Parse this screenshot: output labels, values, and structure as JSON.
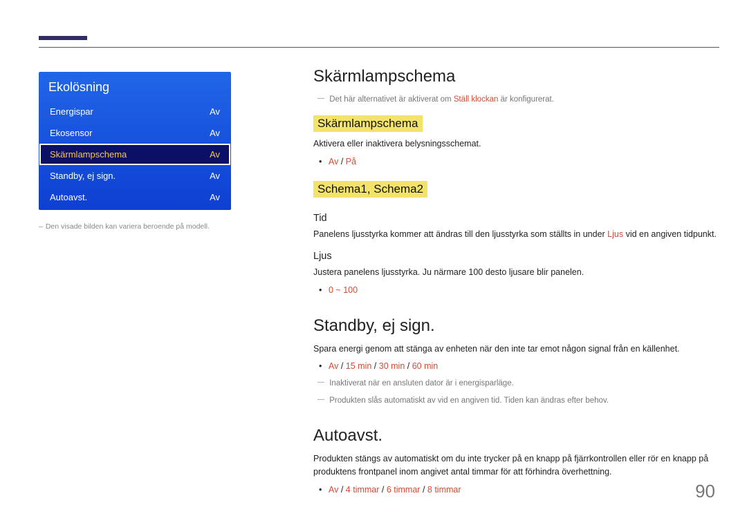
{
  "page_number": "90",
  "sidebar": {
    "title": "Ekolösning",
    "note_prefix": "–",
    "note": "Den visade bilden kan variera beroende på modell.",
    "items": [
      {
        "label": "Energispar",
        "value": "Av",
        "selected": false
      },
      {
        "label": "Ekosensor",
        "value": "Av",
        "selected": false
      },
      {
        "label": "Skärmlampschema",
        "value": "Av",
        "selected": true
      },
      {
        "label": "Standby, ej sign.",
        "value": "Av",
        "selected": false
      },
      {
        "label": "Autoavst.",
        "value": "Av",
        "selected": false
      }
    ]
  },
  "content": {
    "s1": {
      "h1": "Skärmlampschema",
      "note1_prefix": "―",
      "note1_a": "Det här alternativet är aktiverat om ",
      "note1_red": "Ställ klockan",
      "note1_b": " är konfigurerat.",
      "h2a": "Skärmlampschema",
      "h2a_body": "Aktivera eller inaktivera belysningsschemat.",
      "h2a_bullet_a": "Av",
      "h2a_bullet_sep": " / ",
      "h2a_bullet_b": "På",
      "h2b": "Schema1, Schema2",
      "h3_tid": "Tid",
      "tid_body_a": "Panelens ljusstyrka kommer att ändras till den ljusstyrka som ställts in under ",
      "tid_body_red": "Ljus",
      "tid_body_b": " vid en angiven tidpunkt.",
      "h3_ljus": "Ljus",
      "ljus_body": "Justera panelens ljusstyrka. Ju närmare 100 desto ljusare blir panelen.",
      "ljus_bullet": "0 ~ 100"
    },
    "s2": {
      "h1": "Standby, ej sign.",
      "body": "Spara energi genom att stänga av enheten när den inte tar emot någon signal från en källenhet.",
      "bullet_parts": [
        "Av",
        " / ",
        "15 min",
        " / ",
        "30 min",
        " / ",
        "60 min"
      ],
      "note1_prefix": "―",
      "note1": "Inaktiverat när en ansluten dator är i energisparläge.",
      "note2_prefix": "―",
      "note2": "Produkten slås automatiskt av vid en angiven tid. Tiden kan ändras efter behov."
    },
    "s3": {
      "h1": "Autoavst.",
      "body": "Produkten stängs av automatiskt om du inte trycker på en knapp på fjärrkontrollen eller rör en knapp på produktens frontpanel inom angivet antal timmar för att förhindra överhettning.",
      "bullet_parts": [
        "Av",
        " / ",
        "4 timmar",
        " / ",
        "6 timmar",
        " / ",
        "8 timmar"
      ]
    }
  }
}
